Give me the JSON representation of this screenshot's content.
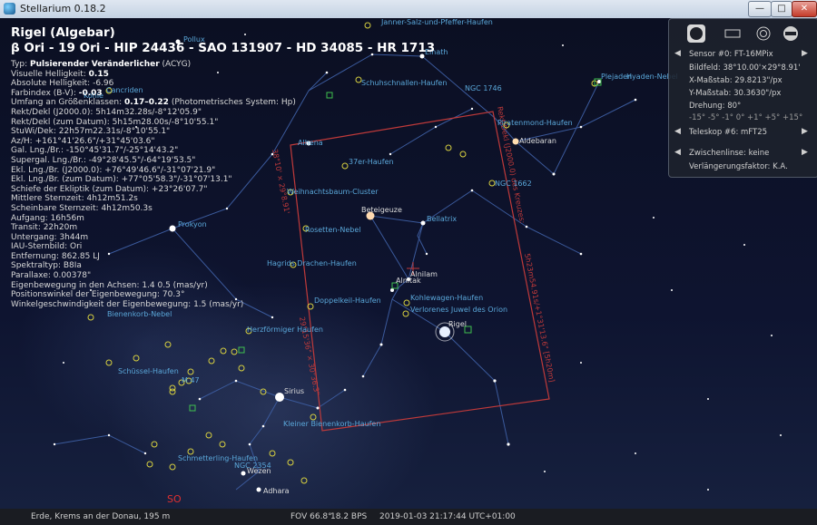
{
  "window": {
    "title": "Stellarium 0.18.2",
    "close_glyph": "✕",
    "max_glyph": "□",
    "min_glyph": "—"
  },
  "object": {
    "name": "Rigel (Algebar)",
    "ids": "β Ori - 19 Ori - HIP 24436 - SAO 131907 - HD 34085 - HR 1713",
    "rows": [
      {
        "label": "Typ: ",
        "value": "Pulsierender Veränderlicher",
        "suffix": " (ACYG)"
      },
      {
        "label": "Visuelle Helligkeit: ",
        "value": "0.15",
        "suffix": ""
      },
      {
        "label": "Absolute Helligkeit: -6.96",
        "value": "",
        "suffix": ""
      },
      {
        "label": "Farbindex (B-V): ",
        "value": "-0.03",
        "suffix": ""
      },
      {
        "label": "Umfang an Größenklassen: ",
        "value": "0.17–0.22",
        "suffix": " (Photometrisches System: Hp)"
      },
      {
        "label": "Rekt/Dekl (J2000.0): 5h14m32.28s/-8°12'05.9\"",
        "value": "",
        "suffix": ""
      },
      {
        "label": "Rekt/Dekl (zum Datum): 5h15m28.00s/-8°10'55.1\"",
        "value": "",
        "suffix": ""
      },
      {
        "label": "StuWi/Dek: 22h57m22.31s/-8°10'55.1\"",
        "value": "",
        "suffix": ""
      },
      {
        "label": "Az/H: +161°41'26.6\"/+31°45'03.6\"",
        "value": "",
        "suffix": ""
      },
      {
        "label": "Gal. Lng./Br.: -150°45'31.7\"/-25°14'43.2\"",
        "value": "",
        "suffix": ""
      },
      {
        "label": "Supergal. Lng./Br.: -49°28'45.5\"/-64°19'53.5\"",
        "value": "",
        "suffix": ""
      },
      {
        "label": "Ekl. Lng./Br. (J2000.0): +76°49'46.6\"/-31°07'21.9\"",
        "value": "",
        "suffix": ""
      },
      {
        "label": "Ekl. Lng./Br. (zum Datum): +77°05'58.3\"/-31°07'13.1\"",
        "value": "",
        "suffix": ""
      },
      {
        "label": "Schiefe der Ekliptik (zum Datum): +23°26'07.7\"",
        "value": "",
        "suffix": ""
      },
      {
        "label": "Mittlere Sternzeit: 4h12m51.2s",
        "value": "",
        "suffix": ""
      },
      {
        "label": "Scheinbare Sternzeit: 4h12m50.3s",
        "value": "",
        "suffix": ""
      },
      {
        "label": "Aufgang: 16h56m",
        "value": "",
        "suffix": ""
      },
      {
        "label": "Transit: 22h20m",
        "value": "",
        "suffix": ""
      },
      {
        "label": "Untergang: 3h44m",
        "value": "",
        "suffix": ""
      },
      {
        "label": "IAU-Sternbild: Ori",
        "value": "",
        "suffix": ""
      },
      {
        "label": "Entfernung: 862.85 LJ",
        "value": "",
        "suffix": ""
      },
      {
        "label": "Spektraltyp: B8Ia",
        "value": "",
        "suffix": ""
      },
      {
        "label": "Parallaxe: 0.00378\"",
        "value": "",
        "suffix": ""
      },
      {
        "label": "Eigenbewegung in den Achsen: 1.4 0.5 (mas/yr)",
        "value": "",
        "suffix": ""
      },
      {
        "label": "Positionswinkel der Eigenbewegung: 70.3°",
        "value": "",
        "suffix": ""
      },
      {
        "label": "Winkelgeschwindigkeit der Eigenbewegung: 1.5 (mas/yr)",
        "value": "",
        "suffix": ""
      }
    ]
  },
  "oculars": {
    "sensor": "Sensor #0: FT-16MPix",
    "bildfeld": "Bildfeld: 38°10.00'×29°8.91'",
    "xmass": "X-Maßstab: 29.8213\"/px",
    "ymass": "Y-Maßstab: 30.3630\"/px",
    "drehung": "Drehung: 80°",
    "rotation_ticks": "-15° -5° -1° 0° +1° +5° +15°",
    "teleskop": "Teleskop #6: mFT25",
    "linse": "Zwischenlinse: keine",
    "verlaengerung": "Verlängerungsfaktor: K.A.",
    "arrow_left": "◀",
    "arrow_right": "▶"
  },
  "sky_labels": [
    {
      "text": "Pollux"
    },
    {
      "text": "Elnath"
    },
    {
      "text": "Janner-Salz-und-Pfeffer-Haufen"
    },
    {
      "text": "Schuhschnallen-Haufen"
    },
    {
      "text": "NGC 1746"
    },
    {
      "text": "Plejaden"
    },
    {
      "text": "Hyaden-Nebel"
    },
    {
      "text": "Piratenmond-Haufen"
    },
    {
      "text": "Aldebaran"
    },
    {
      "text": "Alhena"
    },
    {
      "text": "37er-Haufen"
    },
    {
      "text": "NGC 1662"
    },
    {
      "text": "Weihnachtsbaum-Cluster"
    },
    {
      "text": "Beteigeuze"
    },
    {
      "text": "Bellatrix"
    },
    {
      "text": "Prokyon"
    },
    {
      "text": "Rosetten-Nebel"
    },
    {
      "text": "Hagrids Drachen-Haufen"
    },
    {
      "text": "Alnilam"
    },
    {
      "text": "Alnitak"
    },
    {
      "text": "Kohlewagen-Haufen"
    },
    {
      "text": "Doppelkeil-Haufen"
    },
    {
      "text": "Verlorenes Juwel des Orion"
    },
    {
      "text": "Bienenkorb-Nebel"
    },
    {
      "text": "Rigel"
    },
    {
      "text": "Herzförmiger Haufen"
    },
    {
      "text": "Schüssel-Haufen"
    },
    {
      "text": "M 47"
    },
    {
      "text": "Sirius"
    },
    {
      "text": "Kleiner Bienenkorb-Haufen"
    },
    {
      "text": "Schmetterling-Haufen"
    },
    {
      "text": "NGC 2354"
    },
    {
      "text": "Wezen"
    },
    {
      "text": "Adhara"
    },
    {
      "text": "SO"
    },
    {
      "text": "Cancriden"
    },
    {
      "text": "Kohle"
    }
  ],
  "frame_labels": {
    "top": "Rekt/Dekl (J2000.0) des Kreuzes:",
    "right": "5h23m54.91s/+1°31'13.6\" [5h20m]",
    "left": "38°10' × 29°8.91'",
    "bottom": "29°15'36\" × 30°36.3\""
  },
  "status": {
    "location": "Erde, Krems an der Donau, 195 m",
    "fov": "FOV 66.8°",
    "fps": "18.2 BPS",
    "datetime": "2019-01-03 21:17:44 UTC+01:00"
  },
  "colors": {
    "constellation": "#3b5a9c",
    "label": "#5aa7d9",
    "frame": "#c03a3a",
    "cluster": "#d7d040"
  }
}
